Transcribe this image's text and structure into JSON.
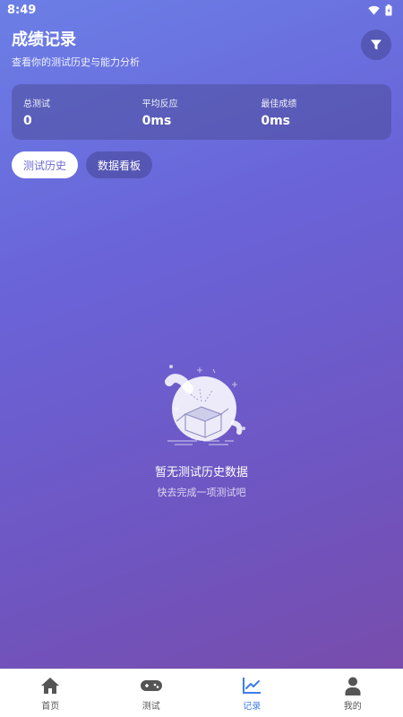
{
  "status_bar": {
    "time": "8:49"
  },
  "header": {
    "title": "成绩记录",
    "subtitle": "查看你的测试历史与能力分析"
  },
  "stats": [
    {
      "label": "总测试",
      "value": "0"
    },
    {
      "label": "平均反应",
      "value": "0ms"
    },
    {
      "label": "最佳成绩",
      "value": "0ms"
    }
  ],
  "tabs": [
    {
      "label": "测试历史",
      "active": true
    },
    {
      "label": "数据看板",
      "active": false
    }
  ],
  "empty_state": {
    "title": "暂无测试历史数据",
    "subtitle": "快去完成一项测试吧"
  },
  "bottom_nav": [
    {
      "label": "首页",
      "icon": "home-icon"
    },
    {
      "label": "测试",
      "icon": "gamepad-icon"
    },
    {
      "label": "记录",
      "icon": "chart-line-icon",
      "active": true
    },
    {
      "label": "我的",
      "icon": "person-icon"
    }
  ],
  "colors": {
    "accent": "#3d7ce8",
    "tab_active_text": "#6c6ad6"
  }
}
